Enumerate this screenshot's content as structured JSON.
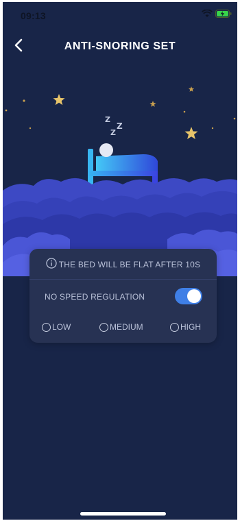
{
  "status_bar": {
    "time": "09:13"
  },
  "header": {
    "title": "ANTI-SNORING SET",
    "back_icon": "chevron-left-icon"
  },
  "illustration": {
    "sleep_text": "ZZZ",
    "elements": [
      "moon-icon",
      "star-icon",
      "bed-icon",
      "cloud-icon"
    ]
  },
  "settings": {
    "notice": "THE BED WILL BE FLAT AFTER 10S",
    "speed_label": "NO SPEED REGULATION",
    "speed_toggle_on": true,
    "options": [
      {
        "label": "LOW",
        "selected": false
      },
      {
        "label": "MEDIUM",
        "selected": false
      },
      {
        "label": "HIGH",
        "selected": false
      }
    ]
  },
  "colors": {
    "background": "#182548",
    "card": "#273253",
    "accent_blue": "#3f7fe6",
    "moon_gold": "#e7c46a"
  }
}
